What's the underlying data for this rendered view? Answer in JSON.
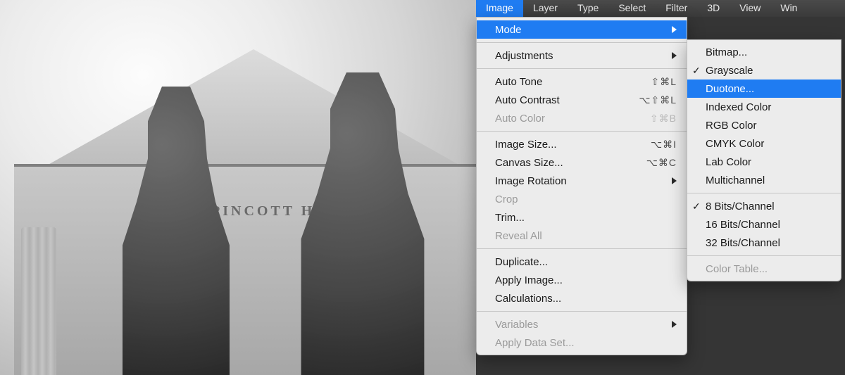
{
  "menubar": {
    "items": [
      "Image",
      "Layer",
      "Type",
      "Select",
      "Filter",
      "3D",
      "View",
      "Win"
    ],
    "active_index": 0
  },
  "canvas": {
    "inscription": "PINCOTT  H"
  },
  "image_menu": [
    {
      "label": "Mode",
      "submenu": true,
      "selected": true
    },
    {
      "sep": true
    },
    {
      "label": "Adjustments",
      "submenu": true
    },
    {
      "sep": true
    },
    {
      "label": "Auto Tone",
      "shortcut": "⇧⌘L"
    },
    {
      "label": "Auto Contrast",
      "shortcut": "⌥⇧⌘L"
    },
    {
      "label": "Auto Color",
      "shortcut": "⇧⌘B",
      "disabled": true
    },
    {
      "sep": true
    },
    {
      "label": "Image Size...",
      "shortcut": "⌥⌘I"
    },
    {
      "label": "Canvas Size...",
      "shortcut": "⌥⌘C"
    },
    {
      "label": "Image Rotation",
      "submenu": true
    },
    {
      "label": "Crop",
      "disabled": true
    },
    {
      "label": "Trim..."
    },
    {
      "label": "Reveal All",
      "disabled": true
    },
    {
      "sep": true
    },
    {
      "label": "Duplicate..."
    },
    {
      "label": "Apply Image..."
    },
    {
      "label": "Calculations..."
    },
    {
      "sep": true
    },
    {
      "label": "Variables",
      "submenu": true,
      "disabled": true
    },
    {
      "label": "Apply Data Set...",
      "disabled": true
    }
  ],
  "mode_submenu": [
    {
      "label": "Bitmap..."
    },
    {
      "label": "Grayscale",
      "checked": true
    },
    {
      "label": "Duotone...",
      "selected": true
    },
    {
      "label": "Indexed Color"
    },
    {
      "label": "RGB Color"
    },
    {
      "label": "CMYK Color"
    },
    {
      "label": "Lab Color"
    },
    {
      "label": "Multichannel"
    },
    {
      "sep": true
    },
    {
      "label": "8 Bits/Channel",
      "checked": true
    },
    {
      "label": "16 Bits/Channel"
    },
    {
      "label": "32 Bits/Channel"
    },
    {
      "sep": true
    },
    {
      "label": "Color Table...",
      "disabled": true
    }
  ]
}
